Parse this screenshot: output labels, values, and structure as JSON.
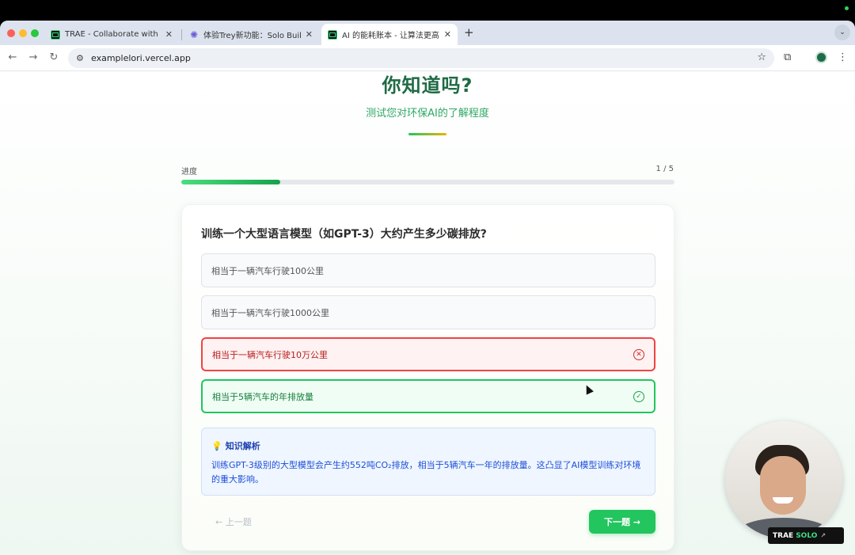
{
  "browser": {
    "tabs": [
      {
        "title": "TRAE - Collaborate with Intelli",
        "icon": "trae-icon",
        "active": false
      },
      {
        "title": "体验Trey新功能：Solo Builder",
        "icon": "gear-icon",
        "active": false
      },
      {
        "title": "AI 的能耗账本 - 让算法更高效、",
        "icon": "trae-icon",
        "active": true
      }
    ],
    "new_tab": "+",
    "url": "examplelori.vercel.app"
  },
  "hero": {
    "title": "你知道吗?",
    "subtitle": "测试您对环保AI的了解程度"
  },
  "progress": {
    "label": "进度",
    "count": "1 / 5",
    "fraction": 0.2
  },
  "quiz": {
    "question": "训练一个大型语言模型（如GPT-3）大约产生多少碳排放?",
    "options": [
      {
        "text": "相当于一辆汽车行驶100公里",
        "state": "neutral"
      },
      {
        "text": "相当于一辆汽车行驶1000公里",
        "state": "neutral"
      },
      {
        "text": "相当于一辆汽车行驶10万公里",
        "state": "wrong"
      },
      {
        "text": "相当于5辆汽车的年排放量",
        "state": "correct"
      }
    ],
    "explanation": {
      "heading": "知识解析",
      "body": "训练GPT-3级别的大型模型会产生约552吨CO₂排放，相当于5辆汽车一年的排放量。这凸显了AI模型训练对环境的重大影响。"
    },
    "prev_label": "← 上一题",
    "next_label": "下一题 →"
  },
  "overlay": {
    "badge_brand": "TRAE",
    "badge_product": "SOLO"
  },
  "colors": {
    "accent": "#22c55e",
    "title": "#1f6b45",
    "wrong": "#ef4444",
    "explain_bg": "#eff6ff"
  }
}
